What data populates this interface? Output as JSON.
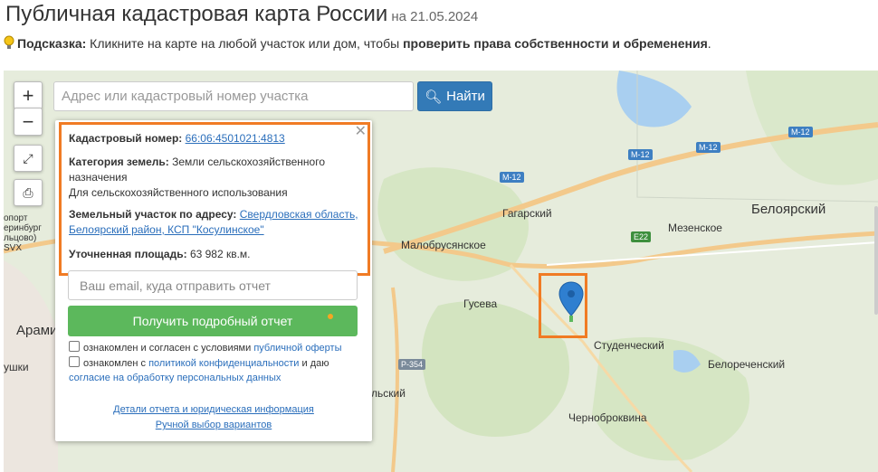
{
  "header": {
    "title": "Публичная кадастровая карта России",
    "date": "на 21.05.2024"
  },
  "hint": {
    "label": "Подсказка:",
    "text": " Кликните на карте на любой участок или дом, чтобы ",
    "bold": "проверить права собственности и обременения",
    "end": "."
  },
  "search": {
    "placeholder": "Адрес или кадастровый номер участка",
    "button": "Найти"
  },
  "map_labels": {
    "gagarsky": "Гагарский",
    "beloyarsky": "Белоярский",
    "mezenskoe": "Мезенское",
    "malobrusyanskoe": "Малобрусянское",
    "guseva": "Гусева",
    "studenchesky": "Студенческий",
    "belorechensky": "Белореченский",
    "chernobrovkina": "Черноброквина",
    "aramil": "Арами",
    "airport": "опорт\nеринбург\nльцово)\nSVX",
    "tsy": "ушки",
    "lsky": "льский",
    "m12": "M-12",
    "e22": "E22",
    "r354": "P-354"
  },
  "popup": {
    "cadastral_label": "Кадастровый номер:",
    "cadastral_value": "66:06:4501021:4813",
    "category_label": "Категория земель:",
    "category_value": "Земли сельскохозяйственного назначения",
    "usage": "Для сельскохозяйственного использования",
    "address_label": "Земельный участок по адресу:",
    "address_value": "Свердловская область, Белоярский район, КСП \"Косулинское\"",
    "area_label": "Уточненная площадь:",
    "area_value": "63 982 кв.м.",
    "email_placeholder": "Ваш email, куда отправить отчет",
    "get_report": "Получить подробный отчет",
    "check1_text": "ознакомлен и согласен с условиями ",
    "check1_link": "публичной оферты",
    "check2_text": "ознакомлен с ",
    "check2_link": "политикой конфиденциальности",
    "check2_mid": " и даю ",
    "check2_link2": "согласие на обработку персональных данных",
    "details_link": "Детали отчета и юридическая информация",
    "manual_link": "Ручной выбор вариантов"
  },
  "colors": {
    "accent_orange": "#f07b24",
    "button_blue": "#337ab7",
    "button_green": "#5cb85c",
    "link": "#2a6ebb"
  }
}
